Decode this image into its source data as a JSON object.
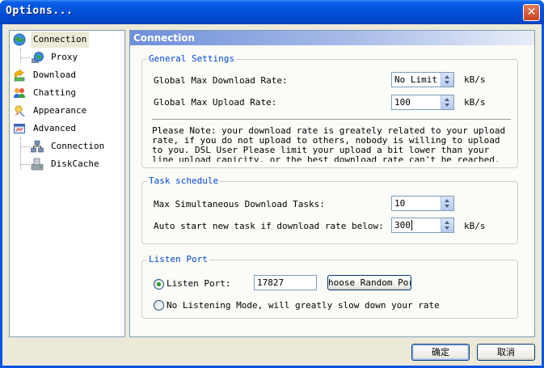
{
  "window": {
    "title": "Options..."
  },
  "sidebar": {
    "items": [
      {
        "label": "Connection",
        "icon": "globe-icon",
        "selected": true
      },
      {
        "label": "Proxy",
        "icon": "proxy-globe-icon"
      },
      {
        "label": "Download",
        "icon": "download-icon"
      },
      {
        "label": "Chatting",
        "icon": "chat-users-icon"
      },
      {
        "label": "Appearance",
        "icon": "appearance-icon"
      },
      {
        "label": "Advanced",
        "icon": "advanced-icon"
      },
      {
        "label": "Connection",
        "icon": "network-icon"
      },
      {
        "label": "DiskCache",
        "icon": "disk-cache-icon"
      }
    ]
  },
  "panel": {
    "title": "Connection",
    "general": {
      "legend": "General Settings",
      "download_label": "Global Max Download Rate:",
      "download_value": "No Limit",
      "upload_label": "Global Max Upload Rate:",
      "upload_value": "100",
      "unit": "kB/s",
      "note": "Please Note: your download rate is greately related to your upload rate, if you do not upload to others, nobody is willing to upload to you. DSL User Please limit your upload a bit lower than your line upload capicity, or the best download rate can't be reached."
    },
    "task": {
      "legend": "Task schedule",
      "max_tasks_label": "Max Simultaneous Download Tasks:",
      "max_tasks_value": "10",
      "auto_start_label": "Auto start new task if download rate below:",
      "auto_start_value": "300",
      "unit": "kB/s"
    },
    "listen": {
      "legend": "Listen Port",
      "port_option_label": "Listen Port:",
      "port_value": "17827",
      "random_port_button": "hoose Random Por",
      "no_listen_label": "No Listening Mode, will greatly slow down your rate",
      "selected": "listen_port"
    }
  },
  "footer": {
    "ok_label": "确定",
    "cancel_label": "取消"
  },
  "colors": {
    "accent": "#0a54e3",
    "legend": "#0046d5",
    "panel_header": "#6e8fd8"
  }
}
